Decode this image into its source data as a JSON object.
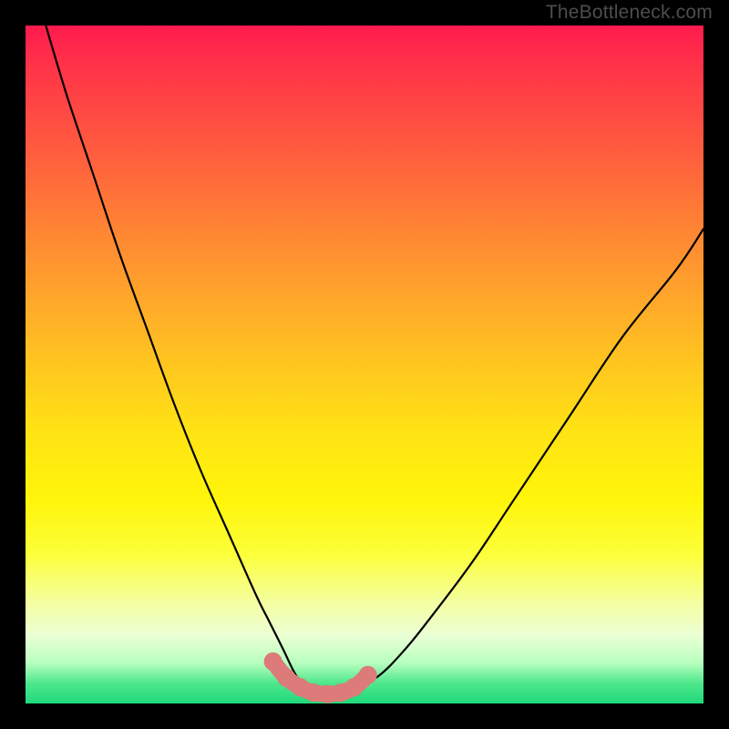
{
  "watermark": "TheBottleneck.com",
  "chart_data": {
    "type": "line",
    "title": "",
    "xlabel": "",
    "ylabel": "",
    "xlim": [
      0,
      100
    ],
    "ylim": [
      0,
      100
    ],
    "grid": false,
    "legend": false,
    "series": [
      {
        "name": "bottleneck-curve",
        "color": "#000000",
        "x": [
          3,
          6,
          10,
          14,
          18,
          22,
          26,
          30,
          34,
          36,
          38,
          40,
          42,
          44,
          46,
          48,
          52,
          56,
          60,
          66,
          72,
          80,
          88,
          96,
          100
        ],
        "values": [
          100,
          90,
          78,
          66,
          55,
          44,
          34,
          25,
          16,
          12,
          8,
          4,
          2,
          1,
          1,
          2,
          4,
          8,
          13,
          21,
          30,
          42,
          54,
          64,
          70
        ]
      }
    ],
    "highlight": {
      "name": "valley-marker",
      "color": "#dd7a7a",
      "x": [
        36.5,
        38.5,
        40.5,
        42.5,
        44.5,
        46.5,
        48.5,
        50.5
      ],
      "values": [
        6.2,
        3.8,
        2.4,
        1.6,
        1.4,
        1.6,
        2.4,
        4.2
      ]
    }
  }
}
